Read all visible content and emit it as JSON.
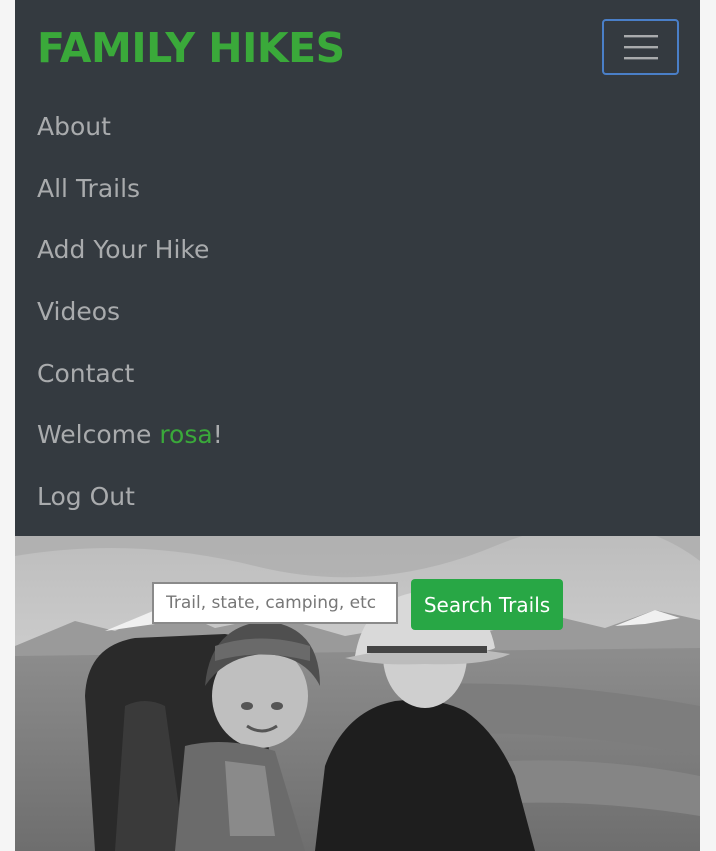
{
  "navbar": {
    "brand": "FAMILY HIKES",
    "toggler_icon": "hamburger-menu-icon",
    "items": [
      {
        "label": "About"
      },
      {
        "label": "All Trails"
      },
      {
        "label": "Add Your Hike"
      },
      {
        "label": "Videos"
      },
      {
        "label": "Contact"
      },
      {
        "welcome_prefix": "Welcome ",
        "username": "rosa",
        "welcome_suffix": "!"
      },
      {
        "label": "Log Out"
      }
    ]
  },
  "hero": {
    "search": {
      "placeholder": "Trail, state, camping, etc",
      "value": "",
      "button_label": "Search Trails"
    }
  },
  "colors": {
    "navbar_bg": "#343a40",
    "brand_green": "#3aa93a",
    "nav_text": "#a9abad",
    "button_green": "#28a745",
    "toggler_border": "#4a7fc8"
  }
}
